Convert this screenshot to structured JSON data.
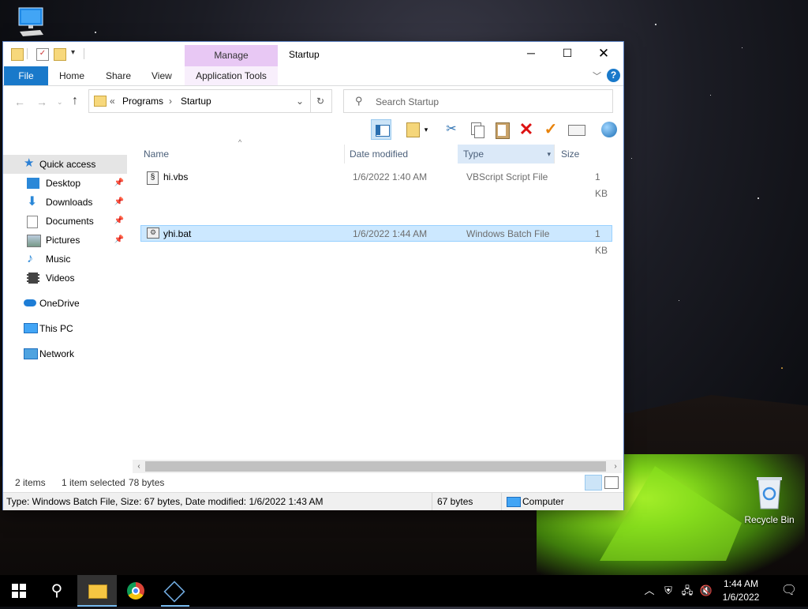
{
  "desktop": {
    "recycle_bin_label": "Recycle Bin"
  },
  "window": {
    "title": "Startup",
    "manage_tab": "Manage",
    "ribbon_tabs": [
      "File",
      "Home",
      "Share",
      "View",
      "Application Tools"
    ],
    "address": {
      "overflow": "«",
      "crumbs": [
        "Programs",
        "Startup"
      ]
    },
    "search_placeholder": "Search Startup",
    "nav": {
      "quick_access": "Quick access",
      "desktop": "Desktop",
      "downloads": "Downloads",
      "documents": "Documents",
      "pictures": "Pictures",
      "music": "Music",
      "videos": "Videos",
      "onedrive": "OneDrive",
      "this_pc": "This PC",
      "network": "Network"
    },
    "columns": {
      "name": "Name",
      "date": "Date modified",
      "type": "Type",
      "size": "Size"
    },
    "files": [
      {
        "name": "hi.vbs",
        "date": "1/6/2022 1:40 AM",
        "type": "VBScript Script File",
        "size": "1 KB"
      },
      {
        "name": "yhi.bat",
        "date": "1/6/2022 1:44 AM",
        "type": "Windows Batch File",
        "size": "1 KB"
      }
    ],
    "status": {
      "items": "2 items",
      "selected": "1 item selected",
      "bytes": "78 bytes"
    },
    "details_bar": {
      "info": "Type: Windows Batch File, Size: 67 bytes, Date modified: 1/6/2022 1:43 AM",
      "size": "67 bytes",
      "location": "Computer"
    }
  },
  "taskbar": {
    "time": "1:44 AM",
    "date": "1/6/2022"
  }
}
